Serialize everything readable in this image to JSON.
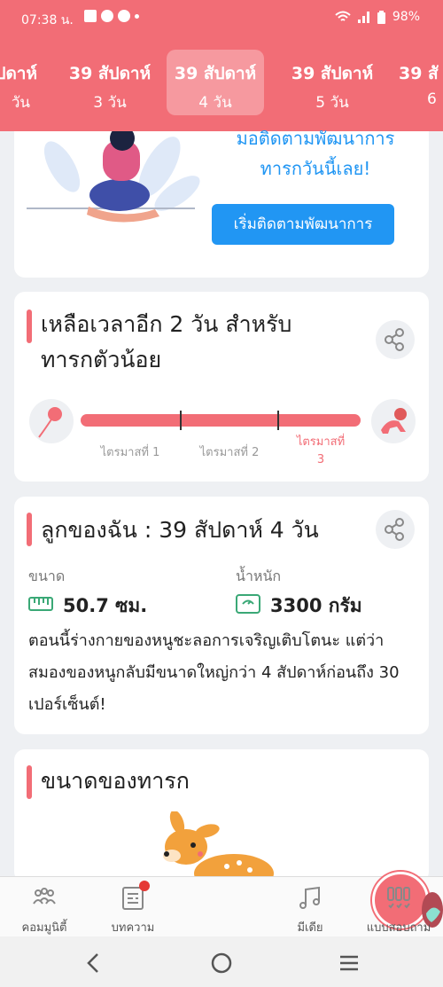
{
  "status_bar": {
    "time": "07:38 น.",
    "battery": "98%"
  },
  "week_tabs": [
    {
      "week": "ปดาห์",
      "day": "วัน"
    },
    {
      "week": "39 สัปดาห์",
      "day": "3 วัน"
    },
    {
      "week": "39 สัปดาห์",
      "day": "4 วัน",
      "active": true
    },
    {
      "week": "39 สัปดาห์",
      "day": "5 วัน"
    },
    {
      "week": "39 สั",
      "day": "6"
    }
  ],
  "promo_card": {
    "line1": "มอติดตามพัฒนาการ",
    "line2": "ทารกวันนี้เลย!",
    "button": "เริ่มติดตามพัฒนาการ"
  },
  "countdown_card": {
    "title_line1": "เหลือเวลาอีก 2 วัน สำหรับ",
    "title_line2": "ทารกตัวน้อย",
    "trimesters": [
      "ไตรมาสที่ 1",
      "ไตรมาสที่ 2",
      "ไตรมาสที่ 3"
    ],
    "current_trimester": 3,
    "progress_fraction": 1.0
  },
  "baby_card": {
    "title": "ลูกของฉัน : 39 สัปดาห์ 4 วัน",
    "size_label": "ขนาด",
    "size_value": "50.7 ซม.",
    "weight_label": "น้ำหนัก",
    "weight_value": "3300 กรัม",
    "description": "ตอนนี้ร่างกายของหนูชะลอการเจริญเติบโตนะ แต่ว่าสมองของหนูกลับมีขนาดใหญ่กว่า 4 สัปดาห์ก่อนถึง 30 เปอร์เซ็นต์!"
  },
  "size_card": {
    "title": "ขนาดของทารก"
  },
  "bottom_nav": {
    "community": "คอมมูนิตี้",
    "articles": "บทความ",
    "media": "มีเดีย",
    "quiz": "แบบสอบถาม"
  },
  "colors": {
    "accent": "#f26d76",
    "button": "#2196f3"
  }
}
